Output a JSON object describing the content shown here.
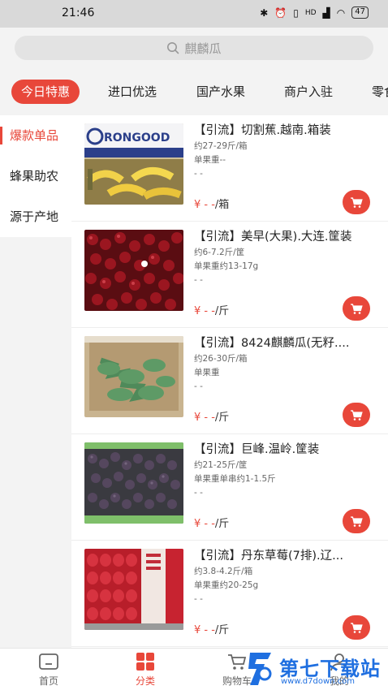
{
  "status_bar": {
    "time": "21:46",
    "signal": "HD",
    "battery": "47"
  },
  "search": {
    "placeholder": "麒麟瓜"
  },
  "tabs": [
    {
      "label": "今日特惠",
      "active": true
    },
    {
      "label": "进口优选"
    },
    {
      "label": "国产水果"
    },
    {
      "label": "商户入驻"
    },
    {
      "label": "零食"
    }
  ],
  "sidebar": {
    "items": [
      {
        "label": "爆款单品",
        "active": true
      },
      {
        "label": "蜂果助农"
      },
      {
        "label": "源于产地"
      }
    ]
  },
  "products": [
    {
      "title": "【引流】切割蕉.越南.箱装",
      "spec": "约27-29斤/箱",
      "weight": "单果重--",
      "extra": "- -",
      "price": "¥ - -",
      "unit": "/箱",
      "image": "banana-box",
      "image_text": "RONGOOD"
    },
    {
      "title": "【引流】美早(大果).大连.筐装",
      "spec": "约6-7.2斤/筐",
      "weight": "单果重约13-17g",
      "extra": "- -",
      "price": "¥ - -",
      "unit": "/斤",
      "image": "cherries"
    },
    {
      "title": "【引流】8424麒麟瓜(无籽....",
      "spec": "约26-30斤/箱",
      "weight": "单果重",
      "extra": "- -",
      "price": "¥ - -",
      "unit": "/斤",
      "image": "watermelon"
    },
    {
      "title": "【引流】巨峰.温岭.筐装",
      "spec": "约21-25斤/筐",
      "weight": "单果重单串约1-1.5斤",
      "extra": "- -",
      "price": "¥ - -",
      "unit": "/斤",
      "image": "grapes"
    },
    {
      "title": "【引流】丹东草莓(7排).辽...",
      "spec": "约3.8-4.2斤/箱",
      "weight": "单果重约20-25g",
      "extra": "- -",
      "price": "¥ - -",
      "unit": "/斤",
      "image": "strawberries"
    }
  ],
  "bottom_nav": [
    {
      "label": "首页",
      "icon": "home-icon"
    },
    {
      "label": "分类",
      "icon": "category-icon",
      "active": true
    },
    {
      "label": "购物车",
      "icon": "cart-icon"
    },
    {
      "label": "我的",
      "icon": "user-icon"
    }
  ],
  "watermark": {
    "title": "第七下载站",
    "url": "www.d7down.com"
  },
  "colors": {
    "accent": "#e8473a",
    "watermark": "#1f6fe0"
  }
}
